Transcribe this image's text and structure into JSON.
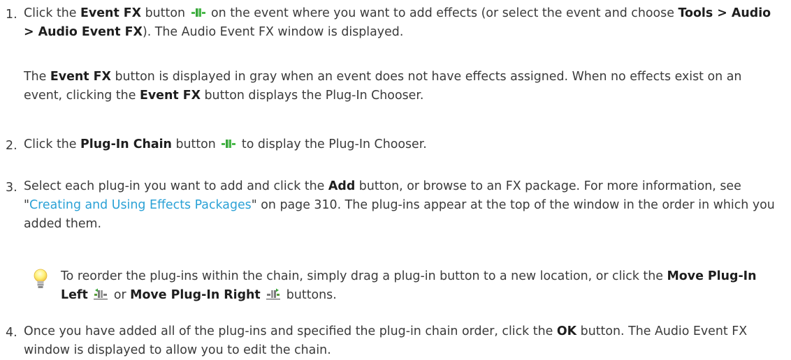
{
  "steps": [
    {
      "num": "1.",
      "p1_a": "Click the ",
      "p1_b": "Event FX",
      "p1_c": " button ",
      "p1_d": " on the event where you want to add effects (or select the event and choose ",
      "p1_e": "Tools > Audio > Audio Event FX",
      "p1_f": "). The Audio Event FX window is displayed.",
      "p2_a": "The ",
      "p2_b": "Event FX",
      "p2_c": " button is displayed in gray when an event does not have effects assigned. When no effects exist on an event, clicking the ",
      "p2_d": "Event FX",
      "p2_e": " button displays the Plug-In Chooser."
    },
    {
      "num": "2.",
      "a": "Click the ",
      "b": "Plug-In Chain",
      "c": " button ",
      "d": " to display the Plug-In Chooser."
    },
    {
      "num": "3.",
      "a": "Select each plug-in you want to add and click the ",
      "b": "Add",
      "c": " button, or browse to an FX package. For more information, see \"",
      "link": "Creating and Using Effects Packages",
      "d": "\" on page 310. The plug-ins appear at the top of the window in the order in which you added them."
    },
    {
      "num": "4.",
      "a": "Once you have added all of the plug-ins and specified the plug-in chain order, click the ",
      "b": "OK",
      "c": " button. The Audio Event FX window is displayed to allow you to edit the chain."
    }
  ],
  "tip": {
    "a": "To reorder the plug-ins within the chain, simply drag a plug-in button to a new location, or click the ",
    "b": "Move Plug-In Left",
    "c": " or ",
    "d": "Move Plug-In Right",
    "e": " buttons."
  },
  "colors": {
    "link": "#2aa1d6",
    "fx_icon": "#49b84a"
  }
}
